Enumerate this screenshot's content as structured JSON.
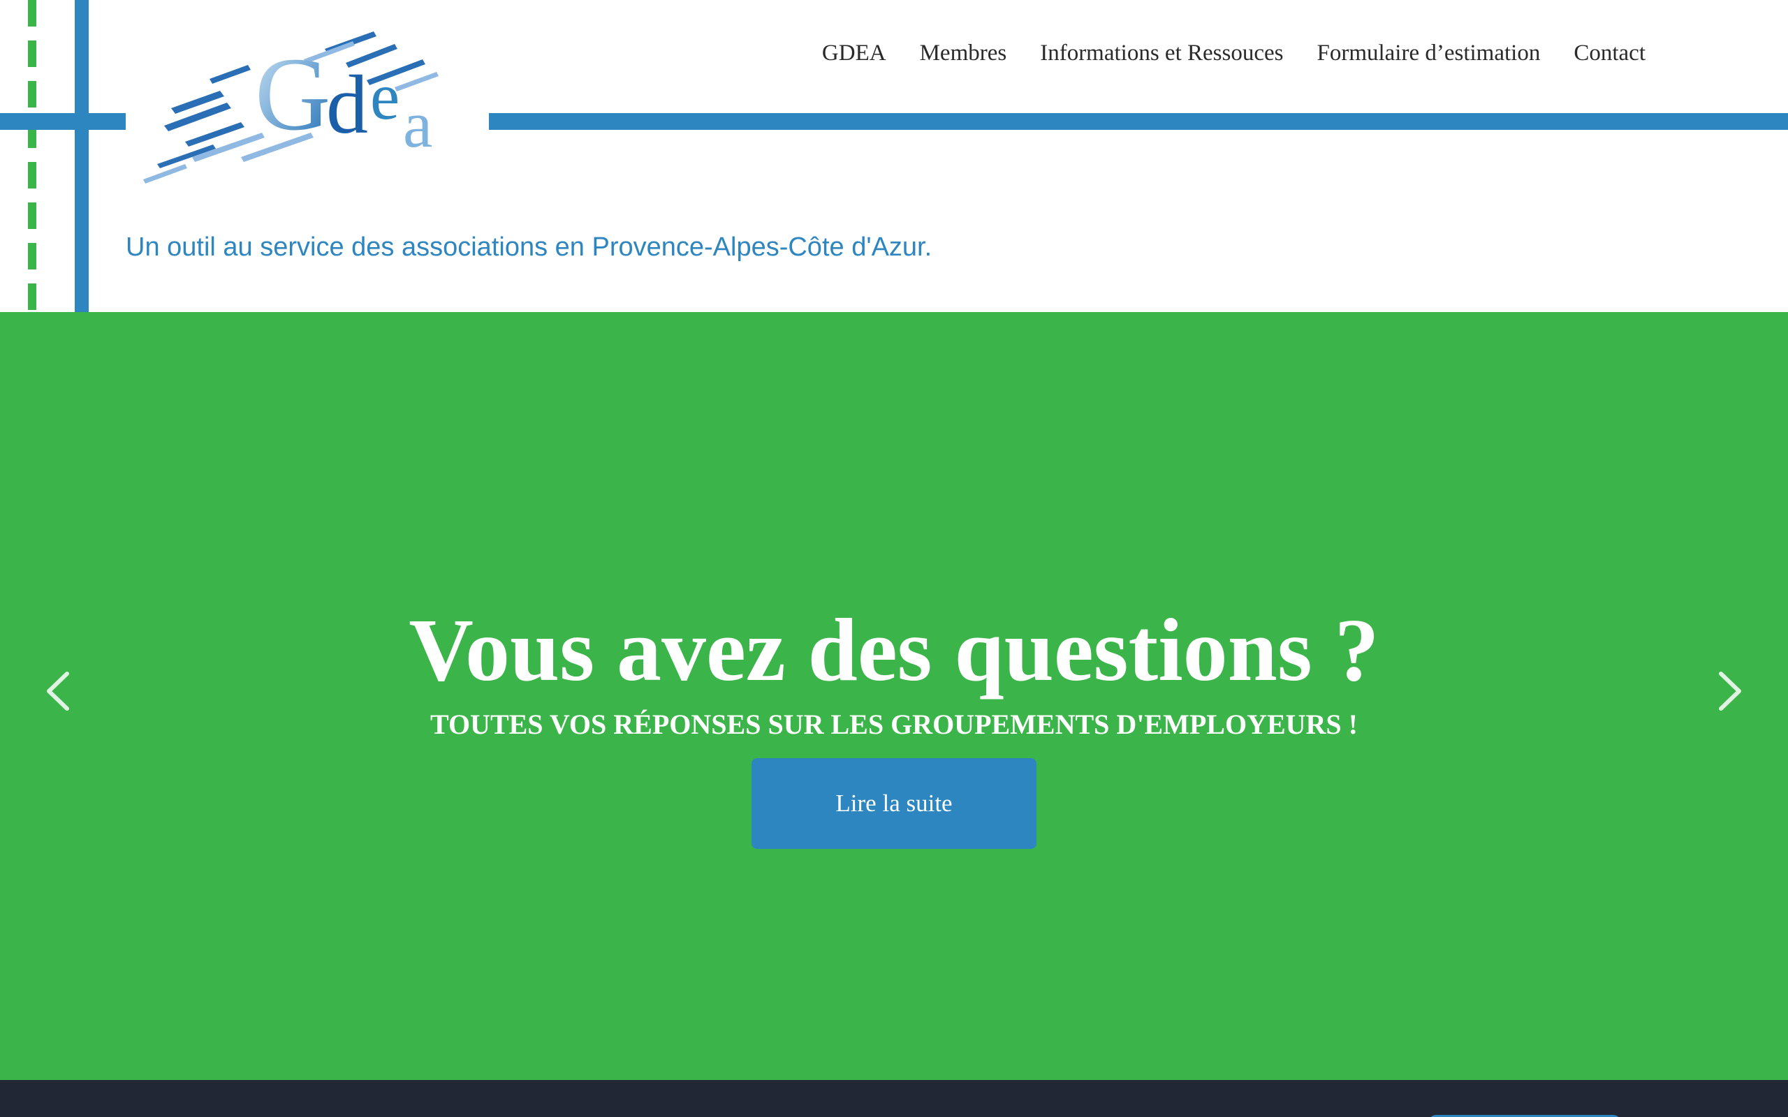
{
  "logo": {
    "alt_text": "Gdea"
  },
  "nav": {
    "items": [
      {
        "label": "GDEA"
      },
      {
        "label": "Membres"
      },
      {
        "label": "Informations et Ressouces"
      },
      {
        "label": "Formulaire d’estimation"
      },
      {
        "label": "Contact"
      }
    ]
  },
  "header": {
    "tagline": "Un outil au service des associations en Provence-Alpes-Côte d'Azur."
  },
  "hero": {
    "title": "Vous avez des questions ?",
    "subtitle": "TOUTES VOS RÉPONSES SUR LES GROUPEMENTS D'EMPLOYEURS !",
    "button_label": "Lire la suite",
    "prev_icon": "chevron-left-icon",
    "next_icon": "chevron-right-icon"
  },
  "colors": {
    "brand_blue": "#2e86c1",
    "hero_green": "#3bb54a",
    "footer_dark": "#222736"
  }
}
